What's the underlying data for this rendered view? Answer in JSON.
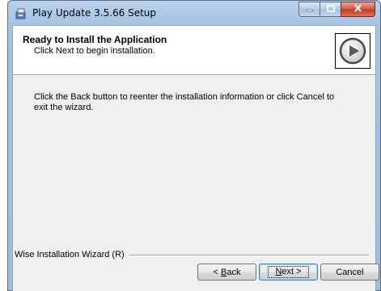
{
  "window": {
    "title": "Play Update 3.5.66 Setup",
    "icons": [
      "installer-icon",
      "minimize-icon",
      "maximize-icon",
      "close-icon"
    ],
    "colors": {
      "frame": "#a7c3e2",
      "close": "#c33a22",
      "client": "#f0f0f0"
    }
  },
  "header": {
    "title": "Ready to Install the Application",
    "subtitle": "Click Next to begin installation.",
    "icon": "play-icon"
  },
  "body": {
    "text": "Click the Back button to reenter the installation information or click Cancel to exit the wizard."
  },
  "footer": {
    "brand": "Wise Installation Wizard (R)",
    "back": {
      "prefix": "< ",
      "mnemonic": "B",
      "rest": "ack"
    },
    "next": {
      "mnemonic": "N",
      "rest": "ext >"
    },
    "cancel": "Cancel"
  }
}
